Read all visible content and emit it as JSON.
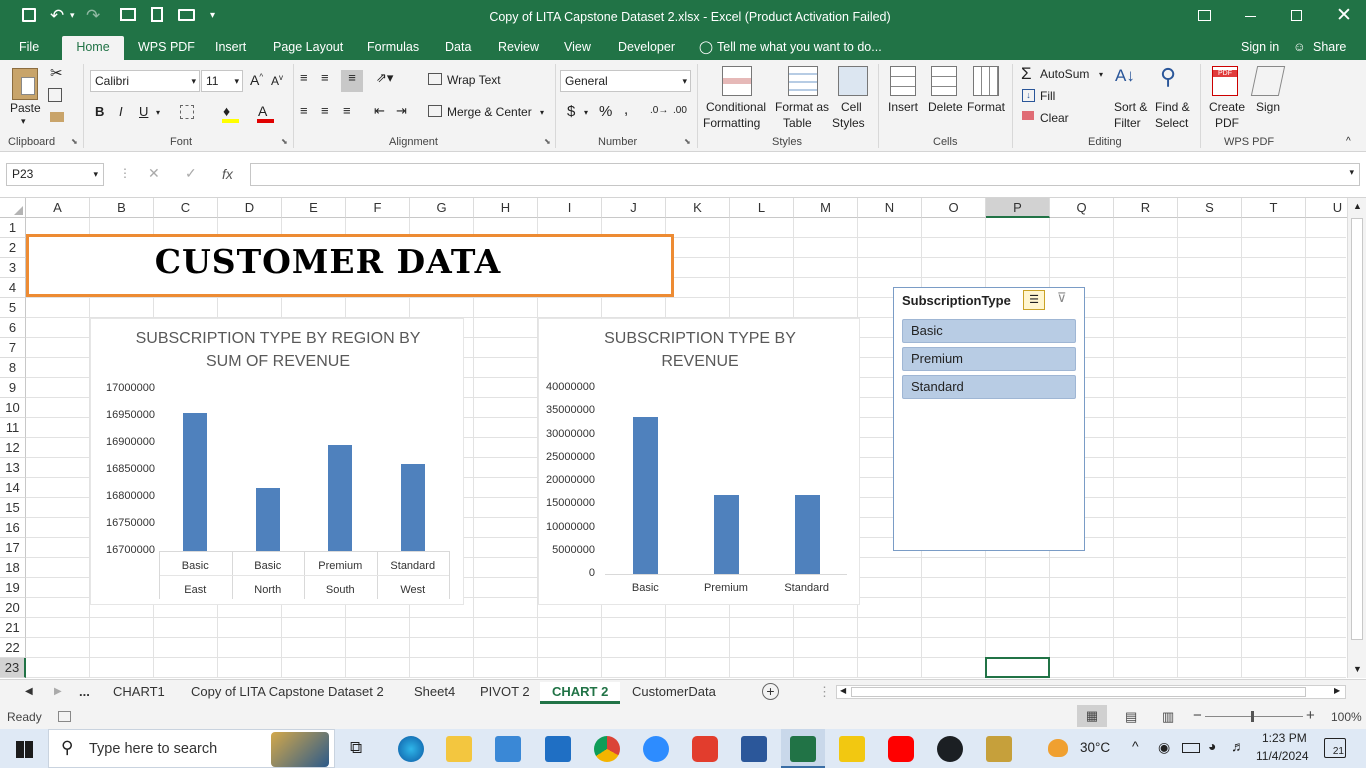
{
  "window": {
    "title": "Copy of LITA Capstone Dataset 2.xlsx  -  Excel (Product Activation Failed)"
  },
  "qat": {
    "save_icon": "save-icon",
    "undo_icon": "undo-icon",
    "redo_icon": "redo-icon"
  },
  "ribbon_tabs": [
    "File",
    "Home",
    "WPS PDF",
    "Insert",
    "Page Layout",
    "Formulas",
    "Data",
    "Review",
    "View",
    "Developer"
  ],
  "tell_me": "Tell me what you want to do...",
  "sign_in": "Sign in",
  "share": "Share",
  "clipboard": {
    "paste": "Paste",
    "label": "Clipboard"
  },
  "font": {
    "name": "Calibri",
    "size": "11",
    "label": "Font",
    "bold": "B",
    "italic": "I",
    "underline": "U"
  },
  "alignment": {
    "wrap": "Wrap Text",
    "merge": "Merge & Center",
    "label": "Alignment"
  },
  "number": {
    "format": "General",
    "currency": "$",
    "percent": "%",
    "comma": ",",
    "label": "Number"
  },
  "styles": {
    "cond1": "Conditional",
    "cond2": "Formatting",
    "table1": "Format as",
    "table2": "Table",
    "cell1": "Cell",
    "cell2": "Styles",
    "label": "Styles"
  },
  "cells": {
    "insert": "Insert",
    "delete": "Delete",
    "format": "Format",
    "label": "Cells"
  },
  "editing": {
    "autosum": "AutoSum",
    "fill": "Fill",
    "clear": "Clear",
    "sort1": "Sort &",
    "sort2": "Filter",
    "find1": "Find &",
    "find2": "Select",
    "label": "Editing"
  },
  "wps": {
    "create1": "Create",
    "create2": "PDF",
    "sign": "Sign",
    "label": "WPS PDF"
  },
  "formula_bar": {
    "namebox": "P23",
    "fx": "fx",
    "formula": ""
  },
  "columns": [
    "A",
    "B",
    "C",
    "D",
    "E",
    "F",
    "G",
    "H",
    "I",
    "J",
    "K",
    "L",
    "M",
    "N",
    "O",
    "P",
    "Q",
    "R",
    "S",
    "T",
    "U"
  ],
  "rows": [
    "1",
    "2",
    "3",
    "4",
    "5",
    "6",
    "7",
    "8",
    "9",
    "10",
    "11",
    "12",
    "13",
    "14",
    "15",
    "16",
    "17",
    "18",
    "19",
    "20",
    "21",
    "22",
    "23"
  ],
  "banner": "CUSTOMER DATA",
  "chart_data": [
    {
      "type": "bar",
      "title": "SUBSCRIPTION TYPE BY REGION BY SUM OF REVENUE",
      "title_line1": "SUBSCRIPTION TYPE BY REGION BY",
      "title_line2": "SUM OF REVENUE",
      "categories": [
        "Basic East",
        "Basic North",
        "Premium South",
        "Standard West"
      ],
      "cat_level1": [
        "Basic",
        "Basic",
        "Premium",
        "Standard"
      ],
      "cat_level2": [
        "East",
        "North",
        "South",
        "West"
      ],
      "values": [
        16955000,
        16817000,
        16897000,
        16862000
      ],
      "yticks": [
        "17000000",
        "16950000",
        "16900000",
        "16850000",
        "16800000",
        "16750000",
        "16700000"
      ],
      "ylim": [
        16700000,
        17000000
      ]
    },
    {
      "type": "bar",
      "title": "SUBSCRIPTION TYPE BY REVENUE",
      "title_line1": "SUBSCRIPTION TYPE BY",
      "title_line2": "REVENUE",
      "categories": [
        "Basic",
        "Premium",
        "Standard"
      ],
      "values": [
        33700000,
        16900000,
        16900000
      ],
      "yticks": [
        "40000000",
        "35000000",
        "30000000",
        "25000000",
        "20000000",
        "15000000",
        "10000000",
        "5000000",
        "0"
      ],
      "ylim": [
        0,
        40000000
      ]
    }
  ],
  "slicer": {
    "title": "SubscriptionType",
    "items": [
      "Basic",
      "Premium",
      "Standard"
    ]
  },
  "sheet_tabs": [
    "...",
    "CHART1",
    "Copy of LITA Capstone Dataset 2",
    "Sheet4",
    "PIVOT 2",
    "CHART 2",
    "CustomerData"
  ],
  "active_sheet": "CHART 2",
  "status": {
    "ready": "Ready",
    "zoom": "100%"
  },
  "taskbar": {
    "search": "Type here to search",
    "temp": "30°C",
    "time": "1:23 PM",
    "date": "11/4/2024",
    "notif": "21"
  },
  "colors": {
    "excel_green": "#217346",
    "bar": "#4f81bd",
    "banner_border": "#ed8b33",
    "slicer_item": "#b8cce4"
  }
}
